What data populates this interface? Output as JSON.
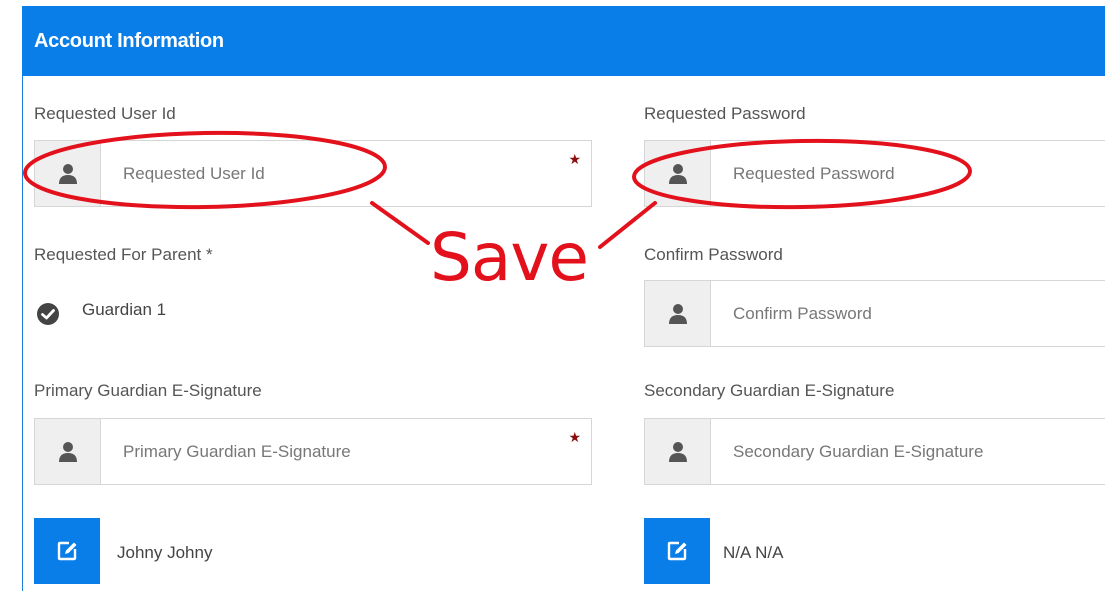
{
  "header": {
    "title": "Account Information"
  },
  "form": {
    "user_id": {
      "label": "Requested User Id",
      "placeholder": "Requested User Id",
      "required_mark": "★"
    },
    "password": {
      "label": "Requested Password",
      "placeholder": "Requested Password"
    },
    "parent": {
      "label": "Requested For Parent *",
      "selected": "Guardian 1"
    },
    "confirm_password": {
      "label": "Confirm Password",
      "placeholder": "Confirm Password"
    },
    "primary_signature": {
      "label": "Primary Guardian E-Signature",
      "placeholder": "Primary Guardian E-Signature",
      "required_mark": "★",
      "signer": "Johny Johny"
    },
    "secondary_signature": {
      "label": "Secondary Guardian E-Signature",
      "placeholder": "Secondary Guardian E-Signature",
      "signer": "N/A N/A"
    }
  },
  "annotation": {
    "text": "Save",
    "color": "#e3111b"
  },
  "colors": {
    "accent": "#0a7ee8",
    "required": "#8b0d0d"
  },
  "icons": [
    "user-icon",
    "check-circle-icon",
    "edit-icon"
  ]
}
